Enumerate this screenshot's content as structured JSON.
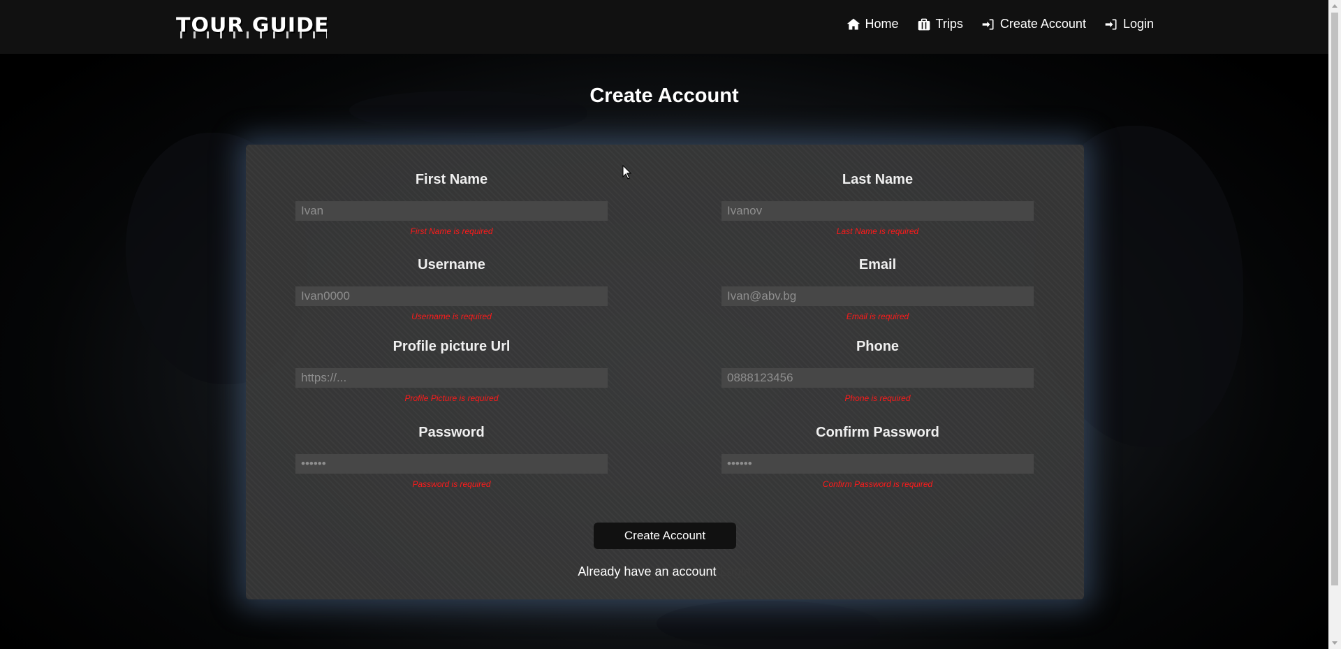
{
  "navbar": {
    "logo": "TOUR GUIDE",
    "links": [
      {
        "label": "Home",
        "icon": "home-icon"
      },
      {
        "label": "Trips",
        "icon": "suitcase-icon"
      },
      {
        "label": "Create Account",
        "icon": "sign-in-icon"
      },
      {
        "label": "Login",
        "icon": "sign-in-icon"
      }
    ]
  },
  "page": {
    "title": "Create Account"
  },
  "form": {
    "fields": [
      {
        "label": "First Name",
        "placeholder": "Ivan",
        "error": "First Name is required"
      },
      {
        "label": "Last Name",
        "placeholder": "Ivanov",
        "error": "Last Name is required"
      },
      {
        "label": "Username",
        "placeholder": "Ivan0000",
        "error": "Username is required"
      },
      {
        "label": "Email",
        "placeholder": "Ivan@abv.bg",
        "error": "Email is required"
      },
      {
        "label": "Profile picture Url",
        "placeholder": "https://...",
        "error": "Profile Picture is required"
      },
      {
        "label": "Phone",
        "placeholder": "0888123456",
        "error": "Phone is required"
      },
      {
        "label": "Password",
        "placeholder": "••••••",
        "error": "Password is required"
      },
      {
        "label": "Confirm Password",
        "placeholder": "••••••",
        "error": "Confirm Password is required"
      }
    ],
    "submit_label": "Create Account",
    "already_text": "Already have an account",
    "login_link": "Login"
  },
  "colors": {
    "navbar_bg": "#111111",
    "card_bg": "#3a3a3a",
    "input_bg": "#474747",
    "error": "#ff1a1a",
    "button_bg": "#111111"
  }
}
